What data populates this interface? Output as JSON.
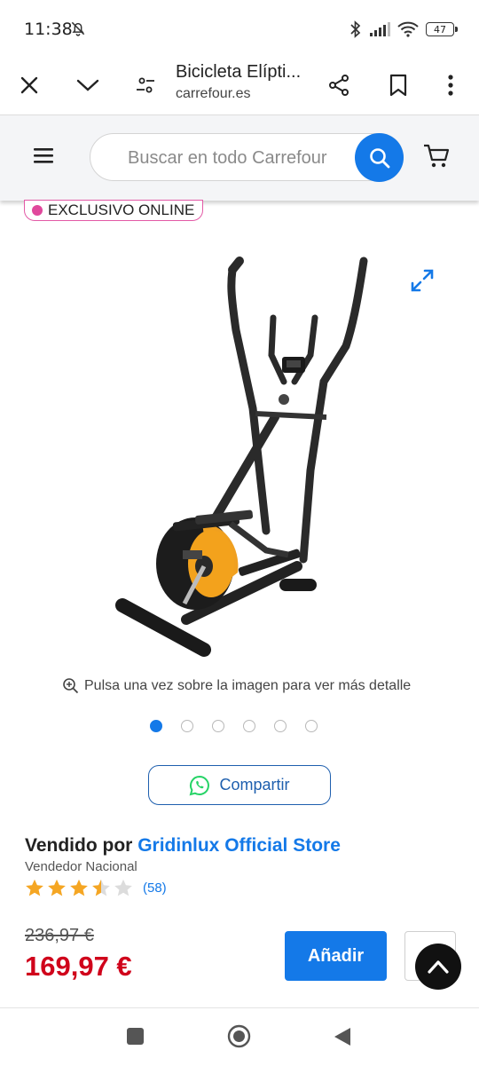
{
  "status_bar": {
    "time": "11:38",
    "battery": "47"
  },
  "browser": {
    "page_title": "Bicicleta Elípti...",
    "domain": "carrefour.es"
  },
  "site_header": {
    "search_placeholder": "Buscar en todo Carrefour"
  },
  "product": {
    "badge": "EXCLUSIVO ONLINE",
    "zoom_hint": "Pulsa una vez sobre la imagen para ver más detalle",
    "image_count": 6,
    "active_image": 1,
    "share_label": "Compartir",
    "sold_by_label": "Vendido por",
    "seller_name": "Gridinlux Official Store",
    "seller_type": "Vendedor Nacional",
    "rating": 3.5,
    "rating_max": 5,
    "rating_count": "(58)",
    "old_price": "236,97 €",
    "price": "169,97 €",
    "add_label": "Añadir"
  },
  "colors": {
    "accent": "#1479e8",
    "price": "#d0021b",
    "badge": "#e0489c",
    "star": "#f5a623",
    "whatsapp": "#25d366"
  },
  "icons": [
    "close-icon",
    "chevron-down-icon",
    "tune-icon",
    "share-icon",
    "bookmark-icon",
    "more-vert-icon",
    "menu-icon",
    "search-icon",
    "cart-icon",
    "expand-icon",
    "zoom-in-icon",
    "whatsapp-icon",
    "arrow-up-icon"
  ]
}
